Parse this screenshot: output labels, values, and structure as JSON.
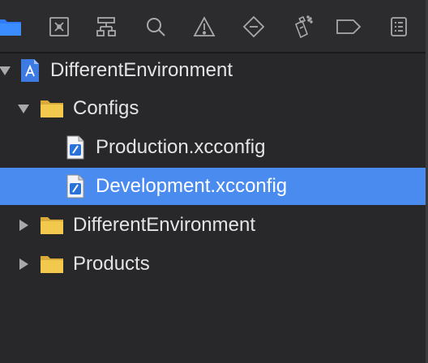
{
  "toolbar": {
    "icons": [
      "project-navigator-folder-icon",
      "source-control-icon",
      "symbol-navigator-icon",
      "find-navigator-icon",
      "issue-navigator-icon",
      "test-navigator-icon",
      "debug-navigator-icon",
      "breakpoint-navigator-icon",
      "report-navigator-icon"
    ],
    "active_index": 0,
    "accent_color": "#2f7cf6"
  },
  "tree": {
    "project": {
      "label": "DifferentEnvironment",
      "expanded": true
    },
    "configs_group": {
      "label": "Configs",
      "expanded": true
    },
    "file_production": {
      "label": "Production.xcconfig"
    },
    "file_development": {
      "label": "Development.xcconfig",
      "selected": true
    },
    "group_different_env": {
      "label": "DifferentEnvironment",
      "expanded": false
    },
    "group_products": {
      "label": "Products",
      "expanded": false
    }
  },
  "colors": {
    "selection": "#4a8bf0",
    "folder": "#f2c94c",
    "text": "#e4e4e6"
  }
}
